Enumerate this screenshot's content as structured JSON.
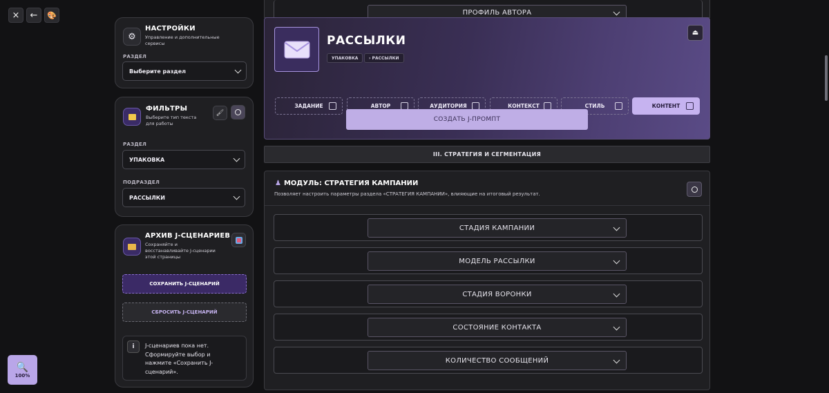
{
  "toolbar": {
    "close_icon": "×",
    "back_icon": "←",
    "palette_icon": "🎨"
  },
  "zoom": {
    "icon": "🔍",
    "label": "100%"
  },
  "settings": {
    "title": "НАСТРОЙКИ",
    "desc_line1": "Управление и дополнительные",
    "desc_line2": "сервисы",
    "section_label": "РАЗДЕЛ",
    "section_value": "Выберите раздел"
  },
  "filters": {
    "title": "ФИЛЬТРЫ",
    "desc_line1": "Выберите тип текста",
    "desc_line2": "для работы",
    "section_label": "РАЗДЕЛ",
    "section_value": "УПАКОВКА",
    "subsection_label": "ПОДРАЗДЕЛ",
    "subsection_value": "РАССЫЛКИ"
  },
  "archive": {
    "title": "АРХИВ J-СЦЕНАРИЕВ",
    "desc_line1": "Сохраняйте и",
    "desc_line2": "восстанавливайте J-сценарии",
    "desc_line3": "этой страницы",
    "save_label": "СОХРАНИТЬ J-СЦЕНАРИЙ",
    "reset_label": "СБРОСИТЬ J-СЦЕНАРИЙ",
    "empty_line1": "J-сценариев пока нет.",
    "empty_line2": "Сформируйте выбор и",
    "empty_line3": "нажмите «Сохранить J-",
    "empty_line4": "сценарий»."
  },
  "top_dropdown": "ПРОФИЛЬ АВТОРА",
  "hero": {
    "title": "РАССЫЛКИ",
    "chip1": "УПАКОВКА",
    "chip2": "› РАССЫЛКИ",
    "tabs": [
      "ЗАДАНИЕ",
      "АВТОР",
      "АУДИТОРИЯ",
      "КОНТЕКСТ",
      "СТИЛЬ",
      "КОНТЕНТ"
    ],
    "create_label": "СОЗДАТЬ J-ПРОМПТ"
  },
  "section_header": "III. СТРАТЕГИЯ И СЕГМЕНТАЦИЯ",
  "module": {
    "title": "МОДУЛЬ: СТРАТЕГИЯ КАМПАНИИ",
    "desc": "Позволяет настроить параметры раздела «СТРАТЕГИЯ КАМПАНИИ», влияющие на итоговый результат.",
    "dropdowns": [
      "СТАДИЯ КАМПАНИИ",
      "МОДЕЛЬ РАССЫЛКИ",
      "СТАДИЯ ВОРОНКИ",
      "СОСТОЯНИЕ КОНТАКТА",
      "КОЛИЧЕСТВО СООБЩЕНИЙ"
    ]
  },
  "colors": {
    "accent": "#c6b3f0",
    "save_bg": "#3b2a66",
    "hero_border": "#5a4e7a"
  }
}
